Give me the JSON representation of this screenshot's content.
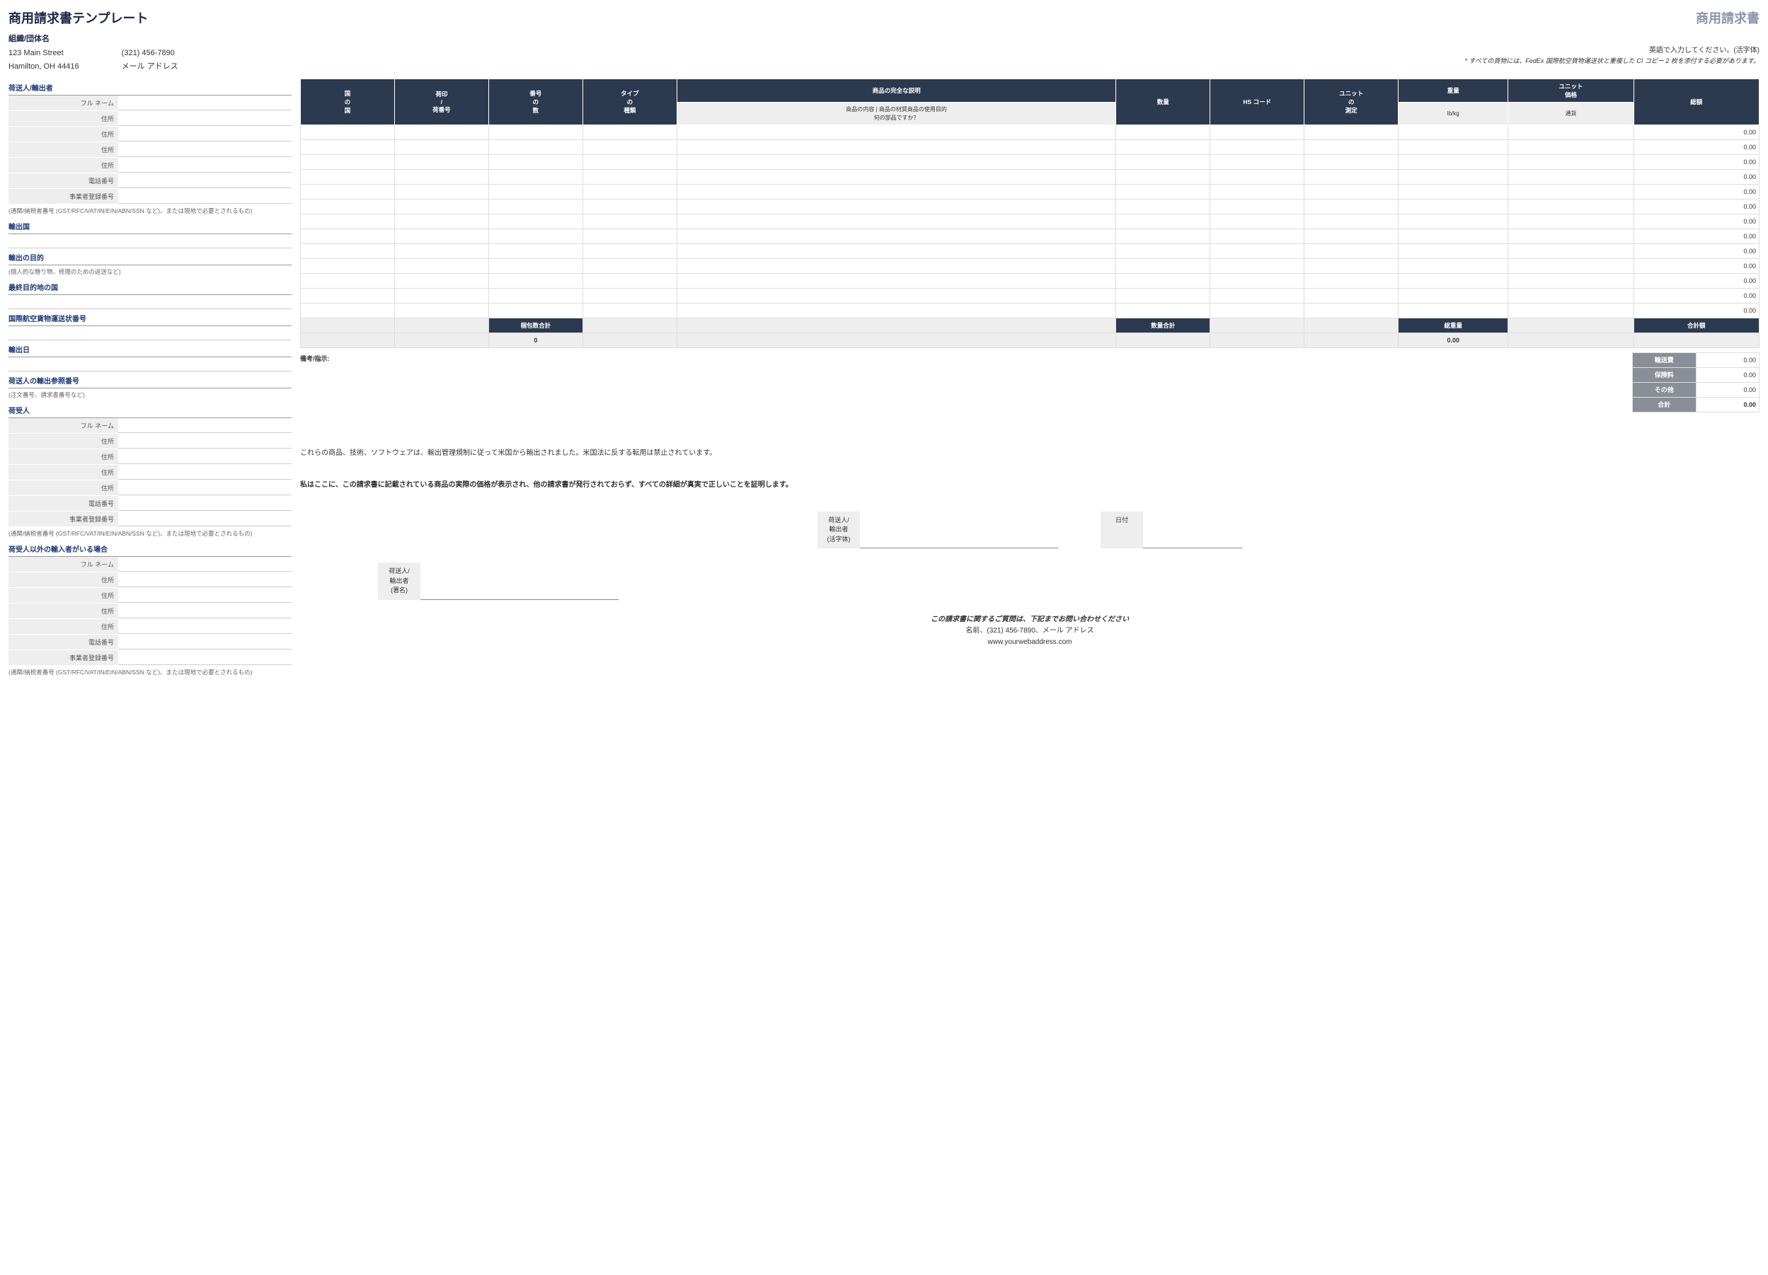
{
  "title": "商用請求書テンプレート",
  "docType": "商用請求書",
  "org": {
    "name": "組織/団体名",
    "addr1": "123 Main Street",
    "addr2": "Hamilton, OH 44416",
    "phone": "(321) 456-7890",
    "email": "メール アドレス"
  },
  "instructions": "英語で入力してください。(活字体)",
  "note": "* すべての貨物には、FedEx 国際航空貨物運送状と重複した CI コピー 2 枚を添付する必要があります。",
  "sections": {
    "shipper": "荷送人/輸出者",
    "exportCountry": "輸出国",
    "exportPurpose": "輸出の目的",
    "exportPurposeHelp": "(個人的な贈り物、修理のための返送など)",
    "destCountry": "最終目的地の国",
    "awb": "国際航空貨物運送状番号",
    "exportDate": "輸出日",
    "shipperRef": "荷送人の輸出参照番号",
    "shipperRefHelp": "(注文番号、請求書番号など)",
    "consignee": "荷受人",
    "importer": "荷受人以外の輸入者がいる場合"
  },
  "taxHelp": "(通関/納税者番号 (GST/RFC/VAT/IN/EIN/ABN/SSN など)、または現地で必要とされるもの)",
  "fields": {
    "fullName": "フル ネーム",
    "address": "住所",
    "phone": "電話番号",
    "taxId": "事業者登録番号"
  },
  "itemsHeader": {
    "country": "国\nの\n国",
    "marks": "荷印\n/\n荷番号",
    "packages": "番号\nの\n数",
    "type": "タイプ\nの\n種類",
    "descTop": "商品の完全な説明",
    "descSub": "商品の内容 | 商品の材質商品の使用目的\n何の部品ですか？",
    "qty": "数量",
    "hs": "HS コード",
    "unit": "ユニット\nの\n測定",
    "weight": "重量",
    "weightSub": "lb/kg",
    "unitPrice": "ユニット\n価格",
    "currency": "通貨",
    "total": "総額"
  },
  "rows": [
    {
      "total": "0.00"
    },
    {
      "total": "0.00"
    },
    {
      "total": "0.00"
    },
    {
      "total": "0.00"
    },
    {
      "total": "0.00"
    },
    {
      "total": "0.00"
    },
    {
      "total": "0.00"
    },
    {
      "total": "0.00"
    },
    {
      "total": "0.00"
    },
    {
      "total": "0.00"
    },
    {
      "total": "0.00"
    },
    {
      "total": "0.00"
    },
    {
      "total": "0.00"
    }
  ],
  "totals": {
    "pkgLabel": "梱包数合計",
    "pkgVal": "0",
    "qtyLabel": "数量合計",
    "qtyVal": "",
    "weightLabel": "総重量",
    "weightVal": "0.00",
    "grandLabel": "合計額",
    "grandVal": ""
  },
  "summary": {
    "shipping": {
      "label": "輸送費",
      "val": "0.00"
    },
    "insurance": {
      "label": "保険料",
      "val": "0.00"
    },
    "other": {
      "label": "その他",
      "val": "0.00"
    },
    "total": {
      "label": "合計",
      "val": "0.00"
    }
  },
  "remarksLabel": "備考/指示:",
  "notice1": "これらの商品、技術、ソフトウェアは、輸出管理規制に従って米国から輸出されました。米国法に反する転用は禁止されています。",
  "notice2": "私はここに、この請求書に記載されている商品の実際の価格が表示され、他の請求書が発行されておらず、すべての詳細が真実で正しいことを証明します。",
  "sign": {
    "printed": "荷送人/\n輸出者\n(活字体)",
    "signature": "荷送人/\n輸出者\n(署名)",
    "date": "日付"
  },
  "footer": {
    "question": "この請求書に関するご質問は、下記までお問い合わせください",
    "contact": "名前、(321) 456-7890、メール アドレス",
    "web": "www.yourwebaddress.com"
  }
}
